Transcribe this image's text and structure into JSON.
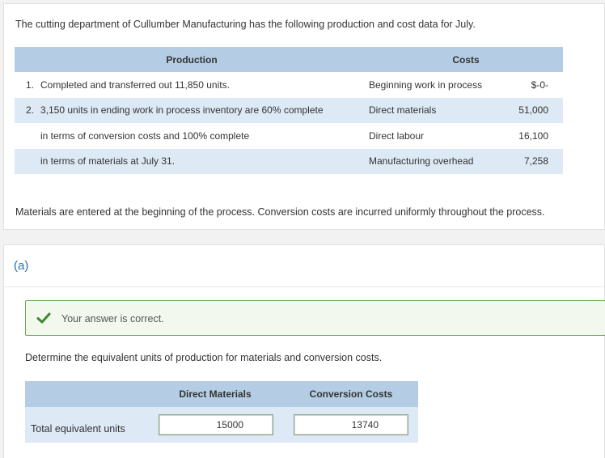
{
  "intro": "The cutting department of Cullumber Manufacturing has the following production and cost data for July.",
  "production_table": {
    "header_production": "Production",
    "header_costs": "Costs",
    "rows": [
      {
        "num": "1.",
        "desc": "Completed and transferred out 11,850 units.",
        "cost_label": "Beginning work in process",
        "amount": "$-0-"
      },
      {
        "num": "2.",
        "desc": "3,150 units in ending work in process inventory are 60% complete",
        "cost_label": "Direct materials",
        "amount": "51,000"
      },
      {
        "num": "",
        "desc": "in terms of conversion costs and 100% complete",
        "cost_label": "Direct labour",
        "amount": "16,100"
      },
      {
        "num": "",
        "desc": "in terms of materials at July 31.",
        "cost_label": "Manufacturing overhead",
        "amount": "7,258"
      }
    ]
  },
  "note": "Materials are entered at the beginning of the process. Conversion costs are incurred uniformly throughout the process.",
  "part": {
    "label": "(a)",
    "feedback": "Your answer is correct.",
    "question": "Determine the equivalent units of production for materials and conversion costs.",
    "eu_table": {
      "col_materials": "Direct Materials",
      "col_conversion": "Conversion Costs",
      "row_label": "Total equivalent units",
      "materials_value": "15000",
      "conversion_value": "13740"
    }
  },
  "colors": {
    "header_blue": "#b4cde4",
    "row_blue": "#dde9f4",
    "success_green": "#3a8a2a",
    "link_blue": "#2d6fa8"
  }
}
